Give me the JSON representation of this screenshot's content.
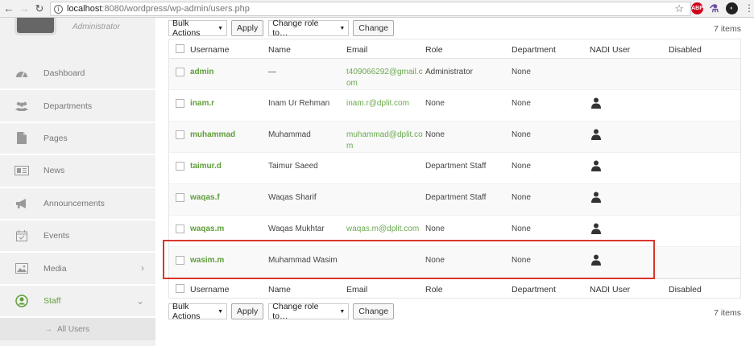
{
  "browser": {
    "url_host": "localhost",
    "url_path": ":8080/wordpress/wp-admin/users.php",
    "ext_abp": "ABP"
  },
  "sidebar": {
    "role": "Administrator",
    "items": [
      {
        "label": "Dashboard",
        "icon": "dashboard-icon"
      },
      {
        "label": "Departments",
        "icon": "users-group-icon"
      },
      {
        "label": "Pages",
        "icon": "page-icon"
      },
      {
        "label": "News",
        "icon": "news-icon"
      },
      {
        "label": "Announcements",
        "icon": "megaphone-icon"
      },
      {
        "label": "Events",
        "icon": "calendar-icon"
      },
      {
        "label": "Media",
        "icon": "media-icon"
      },
      {
        "label": "Staff",
        "icon": "staff-icon"
      }
    ],
    "submenu_label": "All Users",
    "accent": "#5f9e3a"
  },
  "tablenav": {
    "bulk_actions": "Bulk Actions",
    "apply": "Apply",
    "change_role": "Change role to…",
    "change": "Change",
    "items_count": "7 items"
  },
  "columns": {
    "username": "Username",
    "name": "Name",
    "email": "Email",
    "role": "Role",
    "department": "Department",
    "nadi_user": "NADI User",
    "disabled": "Disabled"
  },
  "users": [
    {
      "username": "admin",
      "name": "—",
      "email": "t409066292@gmail.com",
      "role": "Administrator",
      "department": "None",
      "nadi": false
    },
    {
      "username": "inam.r",
      "name": "Inam Ur Rehman",
      "email": "inam.r@dplit.com",
      "role": "None",
      "department": "None",
      "nadi": true
    },
    {
      "username": "muhammad",
      "name": "Muhammad",
      "email": "muhammad@dplit.com",
      "role": "None",
      "department": "None",
      "nadi": true
    },
    {
      "username": "taimur.d",
      "name": "Taimur Saeed",
      "email": "",
      "role": "Department Staff",
      "department": "None",
      "nadi": true
    },
    {
      "username": "waqas.f",
      "name": "Waqas Sharif",
      "email": "",
      "role": "Department Staff",
      "department": "None",
      "nadi": true
    },
    {
      "username": "waqas.m",
      "name": "Waqas Mukhtar",
      "email": "waqas.m@dplit.com",
      "role": "None",
      "department": "None",
      "nadi": true
    },
    {
      "username": "wasim.m",
      "name": "Muhammad Wasim",
      "email": "",
      "role": "None",
      "department": "None",
      "nadi": true
    }
  ],
  "highlight_color": "#d9362a"
}
